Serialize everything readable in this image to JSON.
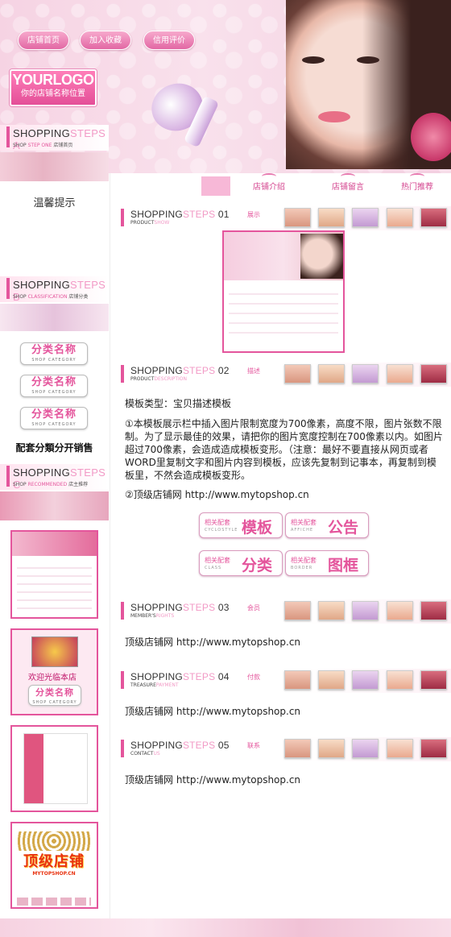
{
  "header": {
    "nav": [
      "店铺首页",
      "加入收藏",
      "信用评价"
    ],
    "logo_main": "YOURLOGO",
    "logo_sub": "你的店铺名称位置"
  },
  "tabs": [
    "店铺介绍",
    "店铺留言",
    "热门推荐"
  ],
  "sidebar": {
    "sections": [
      {
        "big": "SHOPPING",
        "accent": "STEPS A",
        "small_lead": "SHOP",
        "small_mid": "STEP ONE",
        "small_cn": "店铺首页"
      },
      {
        "big": "SHOPPING",
        "accent": "STEPS B",
        "small_lead": "SHOP",
        "small_mid": "CLASSIFICATION",
        "small_cn": "店铺分类"
      },
      {
        "big": "SHOPPING",
        "accent": "STEPS C",
        "small_lead": "SHOP",
        "small_mid": "RECOMMENDED",
        "small_cn": "店主推荐"
      }
    ],
    "notice_title": "温馨提示",
    "category_buttons": [
      {
        "name": "分类名称",
        "sub": "SHOP CATEGORY"
      },
      {
        "name": "分类名称",
        "sub": "SHOP CATEGORY"
      },
      {
        "name": "分类名称",
        "sub": "SHOP CATEGORY"
      }
    ],
    "sale_heading": "配套分類分开销售",
    "welcome_text": "欢迎光临本店",
    "thumb_category": {
      "name": "分类名称",
      "sub": "SHOP CATEGORY"
    },
    "topshop_logo": "顶级店铺",
    "topshop_url": "MYTOPSHOP.CN"
  },
  "steps": [
    {
      "num": "01",
      "small_lead": "PRODUCT",
      "small_en": "SHOW",
      "tag": "展示"
    },
    {
      "num": "02",
      "small_lead": "PRODUCT",
      "small_en": "DESCRIPTION",
      "tag": "描述"
    },
    {
      "num": "03",
      "small_lead": "MEMBER'S",
      "small_en": "RIGHTS",
      "tag": "会员"
    },
    {
      "num": "04",
      "small_lead": "TREASURE",
      "small_en": "PAYMENT",
      "tag": "付款"
    },
    {
      "num": "05",
      "small_lead": "CONTACT",
      "small_en": "US",
      "tag": "联系"
    }
  ],
  "steps_word": {
    "big": "SHOPPING",
    "accent": "STEPS"
  },
  "description": {
    "type_line": "模板类型：宝贝描述模板",
    "para1": "①本模板展示栏中插入图片限制宽度为700像素，高度不限，图片张数不限制。为了显示最佳的效果，请把你的图片宽度控制在700像素以内。如图片超过700像素，会造成造成模板变形。（注意：最好不要直接从网页或者WORD里复制文字和图片内容到模板，应该先复制到记事本，再复制到模板里，不然会造成模板变形。",
    "para2": "②顶级店铺网 http://www.mytopshop.cn"
  },
  "related_buttons": [
    {
      "s1": "相关配套",
      "s2": "CYCLOSTYLE",
      "big": "模板"
    },
    {
      "s1": "相关配套",
      "s2": "AFFICHE",
      "big": "公告"
    },
    {
      "s1": "相关配套",
      "s2": "CLASS",
      "big": "分类"
    },
    {
      "s1": "相关配套",
      "s2": "BORDER",
      "big": "图框"
    }
  ],
  "step_texts": [
    "顶级店铺网 http://www.mytopshop.cn",
    "顶级店铺网 http://www.mytopshop.cn",
    "顶级店铺网 http://www.mytopshop.cn"
  ],
  "colors": {
    "accent": "#e4559c",
    "accent_light": "#f29ac6",
    "header_bg": "#f6d3e3"
  }
}
